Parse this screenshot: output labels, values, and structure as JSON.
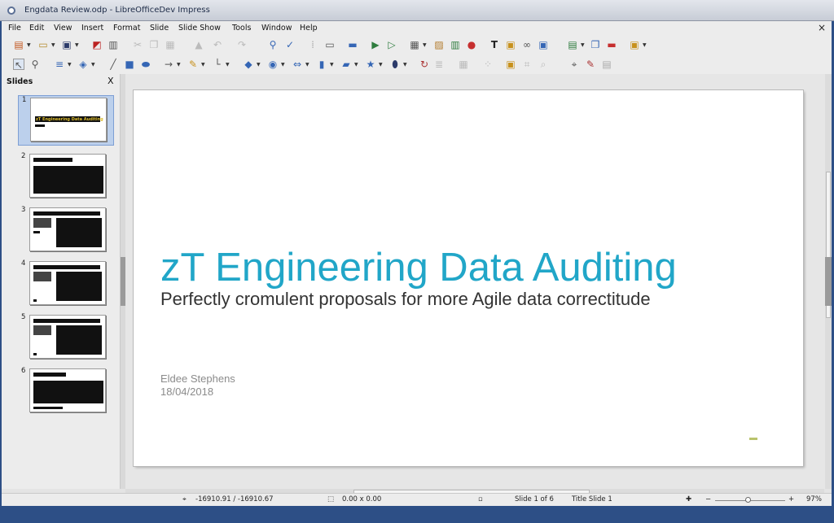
{
  "window": {
    "title": "Engdata Review.odp - LibreOfficeDev Impress"
  },
  "menu": [
    "File",
    "Edit",
    "View",
    "Insert",
    "Format",
    "Slide",
    "Slide Show",
    "Tools",
    "Window",
    "Help"
  ],
  "panel": {
    "title": "Slides",
    "close": "X",
    "slides": [
      "1",
      "2",
      "3",
      "4",
      "5",
      "6"
    ],
    "thumb1_title": "zT Engineering Data Auditing"
  },
  "slide": {
    "title": "zT Engineering Data Auditing",
    "subtitle": "Perfectly cromulent proposals for more Agile data correctitude",
    "author": "Eldee Stephens",
    "date": "18/04/2018"
  },
  "status": {
    "position": "-16910.91 / -16910.67",
    "size": "0.00 x 0.00",
    "slide": "Slide 1 of 6",
    "layout": "Title Slide 1",
    "zoom": "97%"
  },
  "colors": {
    "accent": "#21a6c8",
    "selection": "#bcd0ec"
  }
}
